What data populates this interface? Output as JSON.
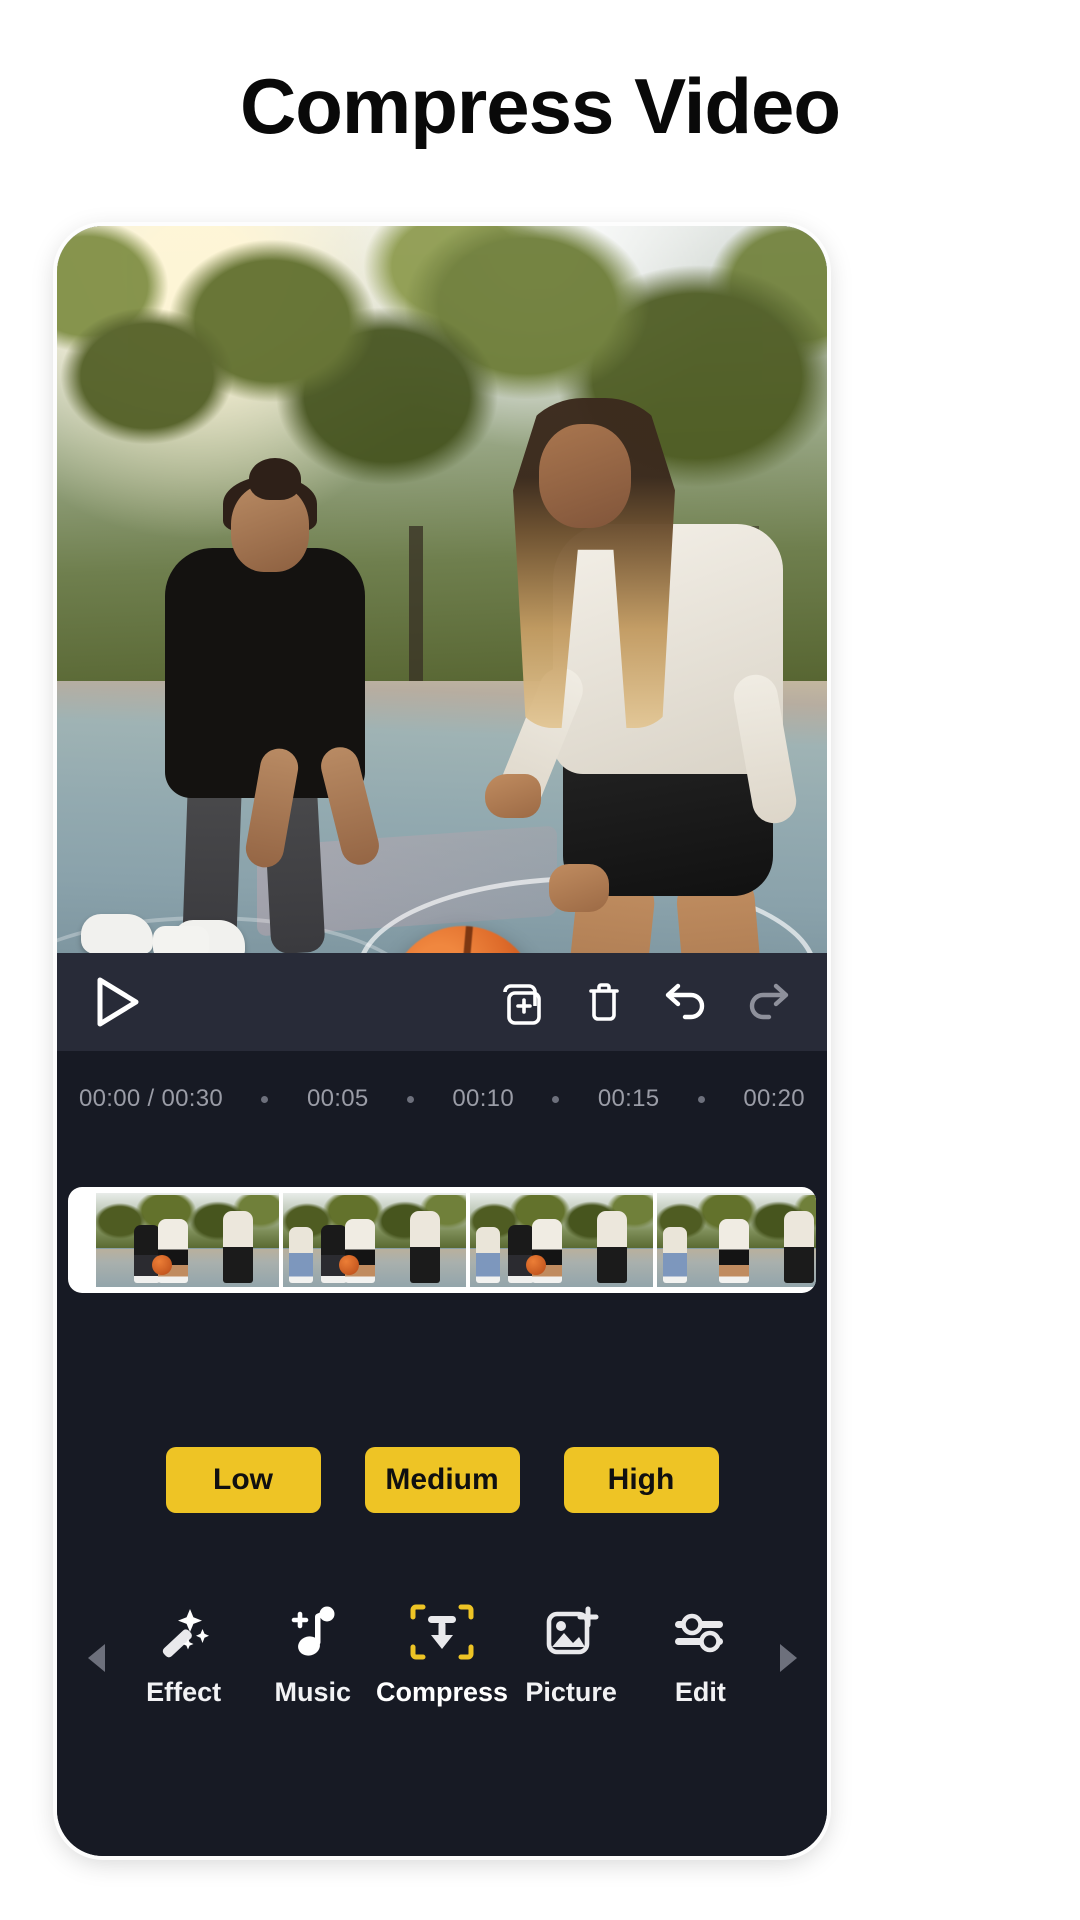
{
  "page": {
    "title": "Compress Video",
    "background_color": "#ffffff",
    "accent_color": "#eec425",
    "panel_color": "#171a24",
    "toolbar_color": "#282b38"
  },
  "player": {
    "play_button_label": "Play",
    "controls": [
      {
        "name": "play",
        "icon": "play-icon",
        "state": "enabled"
      },
      {
        "name": "add-clip",
        "icon": "add-layer-icon",
        "state": "enabled"
      },
      {
        "name": "delete",
        "icon": "trash-icon",
        "state": "enabled"
      },
      {
        "name": "undo",
        "icon": "undo-icon",
        "state": "enabled"
      },
      {
        "name": "redo",
        "icon": "redo-icon",
        "state": "disabled"
      }
    ]
  },
  "timeline": {
    "current_time": "00:00",
    "total_time": "00:30",
    "current_over_total": "00:00 / 00:30",
    "ticks": [
      "00:05",
      "00:10",
      "00:15",
      "00:20"
    ]
  },
  "quality": {
    "options": [
      {
        "label": "Low"
      },
      {
        "label": "Medium"
      },
      {
        "label": "High"
      }
    ]
  },
  "bottom_nav": {
    "scroll_left_icon": "chevron-left-icon",
    "scroll_right_icon": "chevron-right-icon",
    "items": [
      {
        "label": "Effect",
        "icon": "magic-wand-icon",
        "active": false
      },
      {
        "label": "Music",
        "icon": "music-note-add-icon",
        "active": false
      },
      {
        "label": "Compress",
        "icon": "compress-frame-icon",
        "active": true
      },
      {
        "label": "Picture",
        "icon": "image-add-icon",
        "active": false
      },
      {
        "label": "Edit",
        "icon": "sliders-icon",
        "active": false
      }
    ]
  }
}
